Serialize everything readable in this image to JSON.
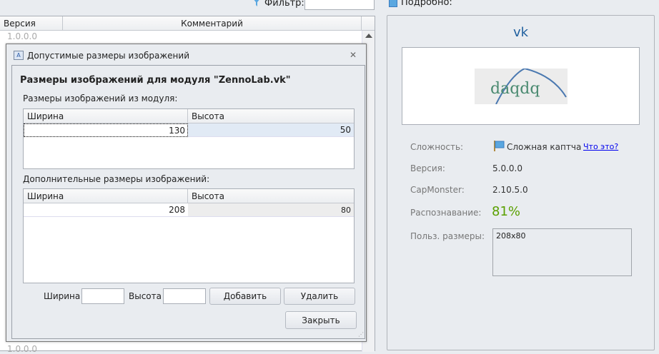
{
  "filter": {
    "label": "Фильтр:",
    "value": ""
  },
  "list": {
    "columns": [
      "Версия",
      "Комментарий"
    ],
    "rows": [
      "1.0.0.0"
    ],
    "bottom_row": "1.0.0.0"
  },
  "dialog": {
    "title": "Допустимые размеры изображений",
    "heading": "Размеры изображений для модуля \"ZennoLab.vk\"",
    "module_label": "Размеры изображений из модуля:",
    "module_table": {
      "columns": [
        "Ширина",
        "Высота"
      ],
      "rows": [
        [
          "130",
          "50"
        ]
      ]
    },
    "extra_label": "Дополнительные размеры изображений:",
    "extra_table": {
      "columns": [
        "Ширина",
        "Высота"
      ],
      "rows": [
        [
          "208",
          "80"
        ]
      ]
    },
    "width_label": "Ширина",
    "height_label": "Высота",
    "add_button": "Добавить",
    "delete_button": "Удалить",
    "close_button": "Закрыть"
  },
  "details": {
    "header": "Подробно:",
    "name": "vk",
    "captcha_text": "daqdq",
    "difficulty_label": "Сложность:",
    "difficulty_value": "Сложная каптча",
    "what_link": "Что это?",
    "version_label": "Версия:",
    "version_value": "5.0.0.0",
    "capmonster_label": "CapMonster:",
    "capmonster_value": "2.10.5.0",
    "recognition_label": "Распознавание:",
    "recognition_value": "81%",
    "sizes_label": "Польз. размеры:",
    "sizes_value": "208x80",
    "accent_color": "#5aa000"
  }
}
